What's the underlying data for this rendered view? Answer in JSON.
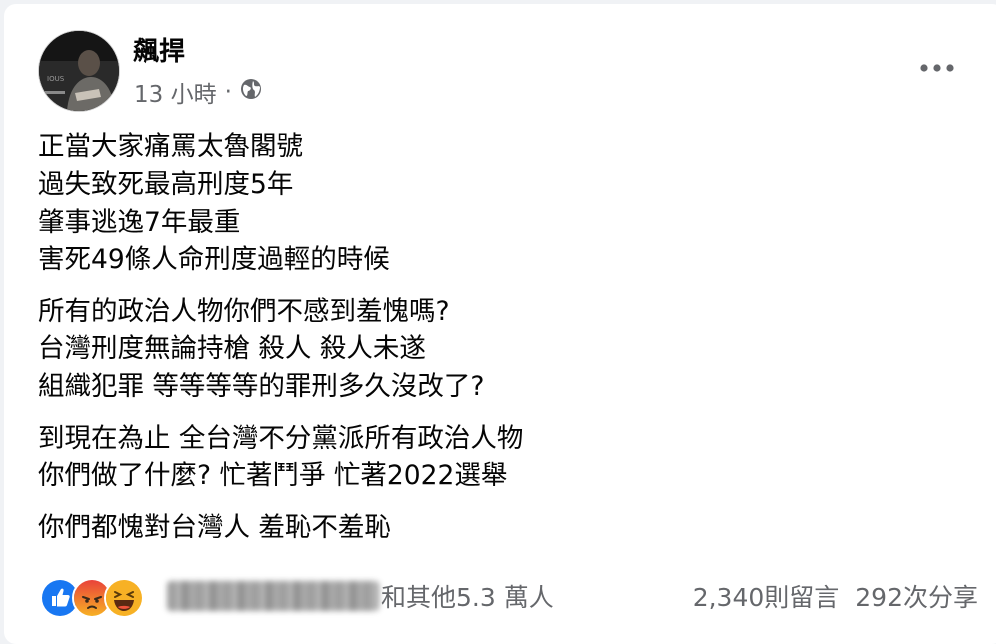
{
  "post": {
    "author": "飆捍",
    "time": "13 小時",
    "separator": "·",
    "privacy_icon": "globe-icon",
    "more_icon": "more-options-icon",
    "paragraphs": [
      [
        "正當大家痛罵太魯閣號",
        "過失致死最高刑度5年",
        "肇事逃逸7年最重",
        "害死49條人命刑度過輕的時候"
      ],
      [
        "所有的政治人物你們不感到羞愧嗎?",
        "台灣刑度無論持槍 殺人 殺人未遂",
        "組織犯罪 等等等等的罪刑多久沒改了?"
      ],
      [
        "到現在為止 全台灣不分黨派所有政治人物",
        "你們做了什麼? 忙著鬥爭 忙著2022選舉"
      ],
      [
        "你們都愧對台灣人 羞恥不羞恥"
      ]
    ]
  },
  "footer": {
    "reaction_icons": [
      "like-icon",
      "angry-icon",
      "haha-icon"
    ],
    "others_text": "和其他5.3 萬人",
    "comments": "2,340則留言",
    "shares": "292次分享"
  },
  "colors": {
    "like": "#1877f2",
    "angry": "#f0533b",
    "haha": "#f7b125",
    "secondary_text": "#65676b"
  }
}
